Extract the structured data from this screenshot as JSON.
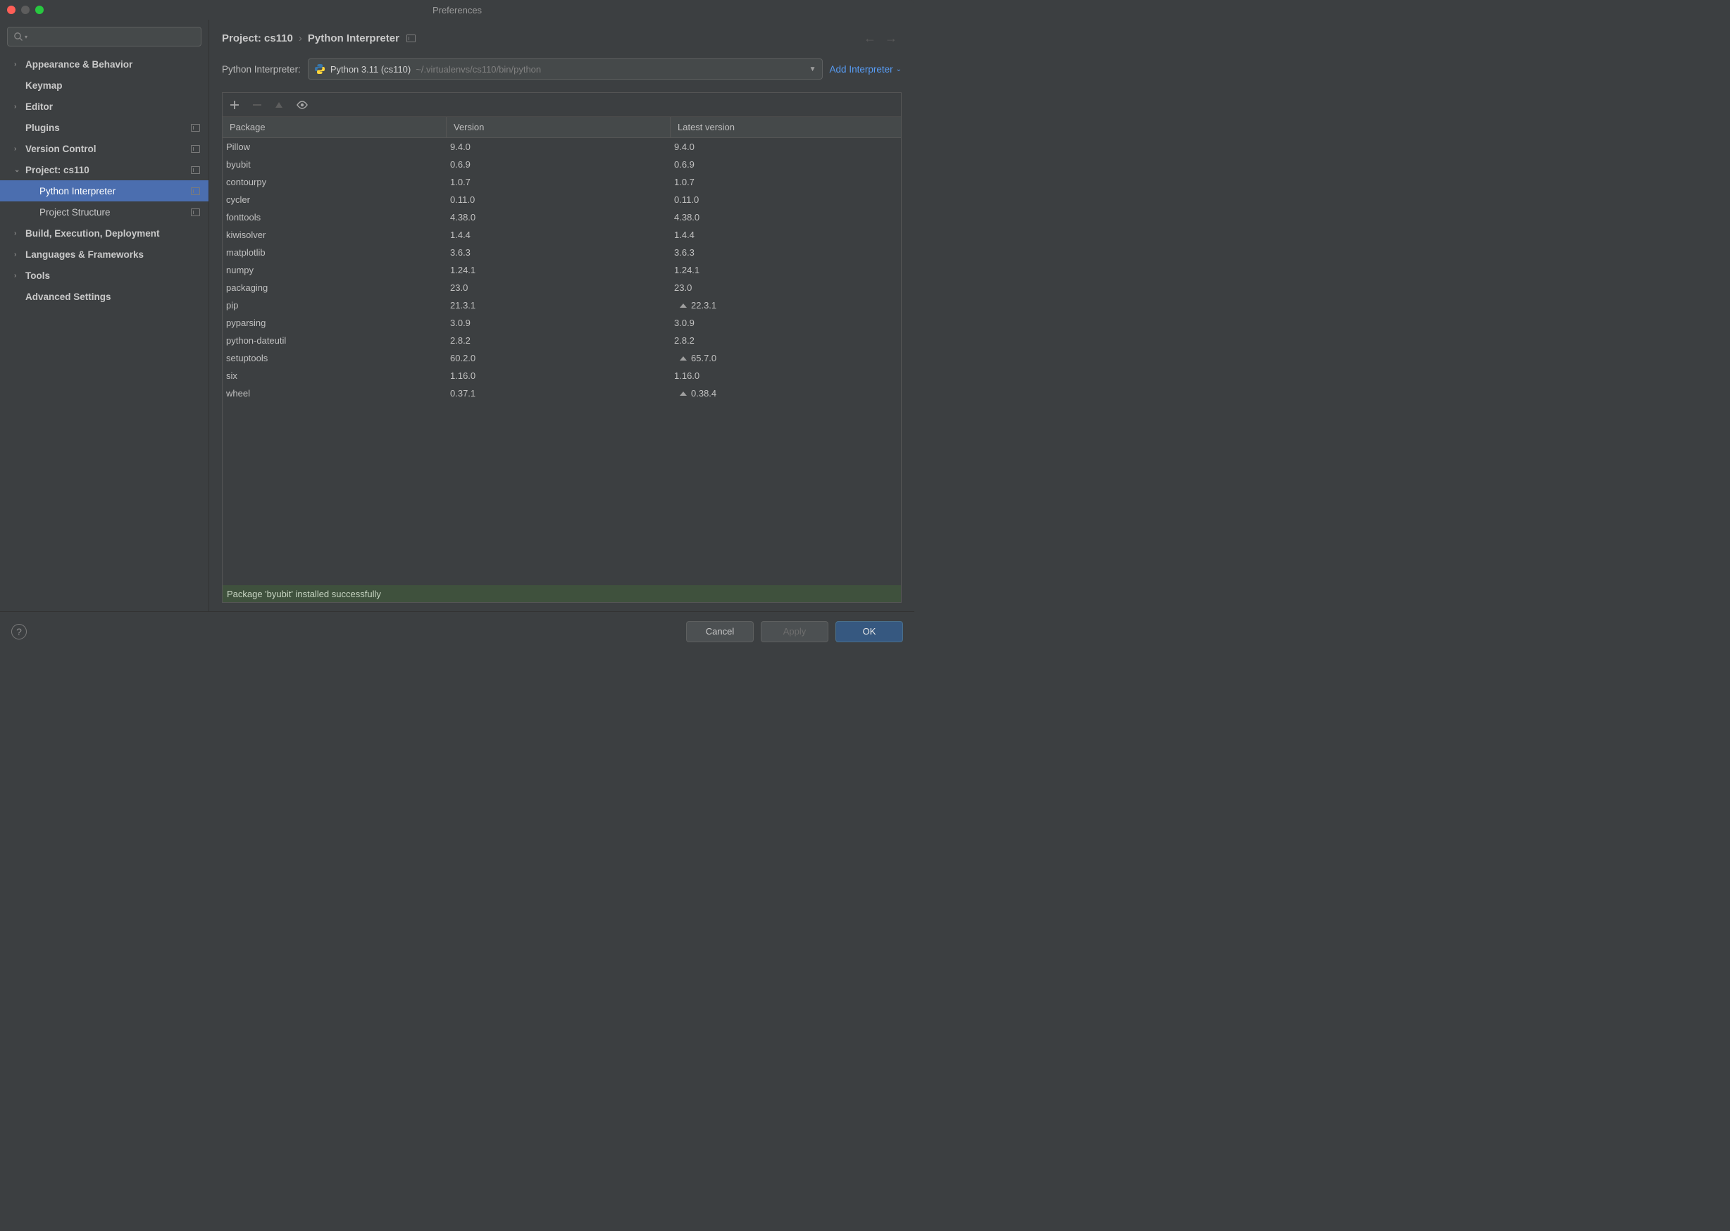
{
  "window": {
    "title": "Preferences"
  },
  "sidebar": {
    "search_placeholder": "",
    "items": [
      {
        "label": "Appearance & Behavior",
        "arrow": "right",
        "bold": true
      },
      {
        "label": "Keymap",
        "arrow": "",
        "bold": true
      },
      {
        "label": "Editor",
        "arrow": "right",
        "bold": true
      },
      {
        "label": "Plugins",
        "arrow": "",
        "bold": true,
        "icon": true
      },
      {
        "label": "Version Control",
        "arrow": "right",
        "bold": true,
        "icon": true
      },
      {
        "label": "Project: cs110",
        "arrow": "down",
        "bold": true,
        "icon": true
      },
      {
        "label": "Python Interpreter",
        "child": true,
        "selected": true,
        "icon": true
      },
      {
        "label": "Project Structure",
        "child": true,
        "icon": true
      },
      {
        "label": "Build, Execution, Deployment",
        "arrow": "right",
        "bold": true
      },
      {
        "label": "Languages & Frameworks",
        "arrow": "right",
        "bold": true
      },
      {
        "label": "Tools",
        "arrow": "right",
        "bold": true
      },
      {
        "label": "Advanced Settings",
        "arrow": "",
        "bold": true
      }
    ]
  },
  "breadcrumb": {
    "segments": [
      "Project: cs110",
      "Python Interpreter"
    ]
  },
  "interpreter": {
    "label": "Python Interpreter:",
    "name": "Python 3.11 (cs110)",
    "path": "~/.virtualenvs/cs110/bin/python",
    "add_label": "Add Interpreter"
  },
  "packages": {
    "columns": [
      "Package",
      "Version",
      "Latest version"
    ],
    "rows": [
      {
        "name": "Pillow",
        "version": "9.4.0",
        "latest": "9.4.0",
        "upgrade": false
      },
      {
        "name": "byubit",
        "version": "0.6.9",
        "latest": "0.6.9",
        "upgrade": false
      },
      {
        "name": "contourpy",
        "version": "1.0.7",
        "latest": "1.0.7",
        "upgrade": false
      },
      {
        "name": "cycler",
        "version": "0.11.0",
        "latest": "0.11.0",
        "upgrade": false
      },
      {
        "name": "fonttools",
        "version": "4.38.0",
        "latest": "4.38.0",
        "upgrade": false
      },
      {
        "name": "kiwisolver",
        "version": "1.4.4",
        "latest": "1.4.4",
        "upgrade": false
      },
      {
        "name": "matplotlib",
        "version": "3.6.3",
        "latest": "3.6.3",
        "upgrade": false
      },
      {
        "name": "numpy",
        "version": "1.24.1",
        "latest": "1.24.1",
        "upgrade": false
      },
      {
        "name": "packaging",
        "version": "23.0",
        "latest": "23.0",
        "upgrade": false
      },
      {
        "name": "pip",
        "version": "21.3.1",
        "latest": "22.3.1",
        "upgrade": true
      },
      {
        "name": "pyparsing",
        "version": "3.0.9",
        "latest": "3.0.9",
        "upgrade": false
      },
      {
        "name": "python-dateutil",
        "version": "2.8.2",
        "latest": "2.8.2",
        "upgrade": false
      },
      {
        "name": "setuptools",
        "version": "60.2.0",
        "latest": "65.7.0",
        "upgrade": true
      },
      {
        "name": "six",
        "version": "1.16.0",
        "latest": "1.16.0",
        "upgrade": false
      },
      {
        "name": "wheel",
        "version": "0.37.1",
        "latest": "0.38.4",
        "upgrade": true
      }
    ]
  },
  "status": {
    "message": "Package 'byubit' installed successfully"
  },
  "footer": {
    "cancel": "Cancel",
    "apply": "Apply",
    "ok": "OK"
  }
}
